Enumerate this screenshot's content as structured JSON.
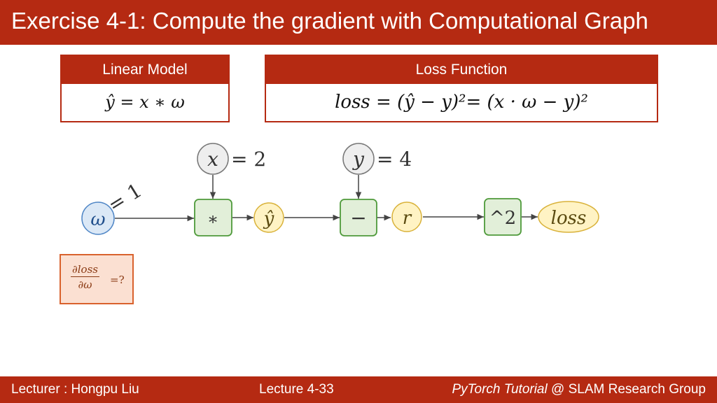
{
  "title": "Exercise 4-1: Compute the gradient with Computational Graph",
  "linear_model": {
    "header": "Linear Model",
    "formula": "ŷ = x ∗ ω"
  },
  "loss_function": {
    "header": "Loss Function",
    "formula": "loss = (ŷ − y)²= (x · ω − y)²"
  },
  "graph": {
    "omega_node": "ω",
    "omega_value": "= 1",
    "x_node": "x",
    "x_value": "= 2",
    "y_node": "y",
    "y_value": "= 4",
    "mul_op": "∗",
    "yhat_node": "ŷ",
    "sub_op": "−",
    "r_node": "r",
    "square_op": "^2",
    "loss_node": "loss"
  },
  "question": {
    "numerator": "∂loss",
    "denominator": "∂ω",
    "suffix": "=?"
  },
  "footer": {
    "lecturer": "Lecturer : Hongpu Liu",
    "lecture": "Lecture 4-33",
    "course": "PyTorch Tutorial",
    "group": " @ SLAM Research Group"
  },
  "colors": {
    "brand_red": "#b52a12",
    "op_node_fill": "#e2efd9",
    "op_node_stroke": "#4e9a3a",
    "var_node_fill": "#fff3c4",
    "var_node_stroke": "#d9b23a",
    "input_node_fill": "#eeeeee",
    "omega_fill": "#dbe8f6",
    "omega_stroke": "#4f86c6",
    "question_fill": "#fbe0d2"
  }
}
